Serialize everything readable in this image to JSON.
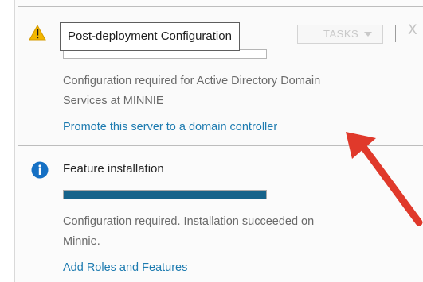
{
  "notifications": [
    {
      "type": "warning",
      "icon": "warning-icon",
      "title": "Post-deployment Configuration",
      "tasks_label": "TASKS",
      "close_glyph": "X",
      "progress": 0,
      "message_lines": [
        "Configuration required for Active Directory Domain",
        "Services at MINNIE"
      ],
      "link": "Promote this server to a domain controller"
    },
    {
      "type": "info",
      "icon": "info-icon",
      "title": "Feature installation",
      "progress": 1.0,
      "message_lines": [
        "Configuration required. Installation succeeded on",
        "Minnie."
      ],
      "link": "Add Roles and Features"
    }
  ],
  "colors": {
    "link": "#1d7bb0",
    "progress_fill": "#16638a",
    "warning": "#f2b600",
    "info": "#1570c4",
    "annotation_arrow": "#e0392b"
  },
  "annotation": {
    "icon": "red-arrow-pointer"
  }
}
